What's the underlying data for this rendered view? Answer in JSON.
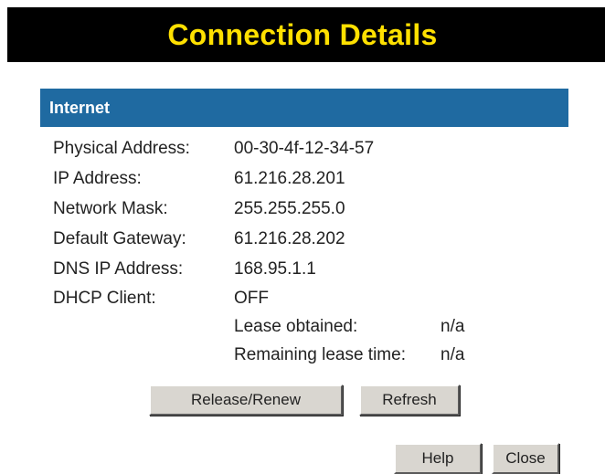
{
  "page": {
    "title": "Connection Details"
  },
  "internet": {
    "section_title": "Internet",
    "fields": [
      {
        "label": "Physical Address:",
        "value": "00-30-4f-12-34-57"
      },
      {
        "label": "IP Address:",
        "value": "61.216.28.201"
      },
      {
        "label": "Network Mask:",
        "value": "255.255.255.0"
      },
      {
        "label": "Default Gateway:",
        "value": "61.216.28.202"
      },
      {
        "label": "DNS IP Address:",
        "value": "168.95.1.1"
      },
      {
        "label": "DHCP Client:",
        "value": "OFF"
      }
    ],
    "lease_obtained_label": "Lease obtained:",
    "lease_obtained_value": "n/a",
    "remaining_lease_label": "Remaining lease time:",
    "remaining_lease_value": "n/a"
  },
  "buttons": {
    "release_renew": "Release/Renew",
    "refresh": "Refresh",
    "help": "Help",
    "close": "Close"
  },
  "colors": {
    "title_background": "#000000",
    "title_text": "#ffe000",
    "section_header_background": "#1f6aa1",
    "section_header_text": "#ffffff",
    "button_face": "#d9d6d0"
  }
}
